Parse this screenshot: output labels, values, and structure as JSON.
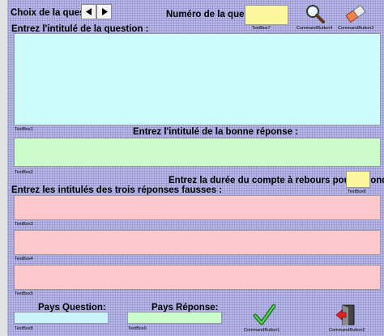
{
  "header": {
    "choix_label": "Choix de la question",
    "numero_label": "Numéro de la question :",
    "textbox7": "TextBox7",
    "cmd4": "CommandButton4",
    "cmd3": "CommandButton3"
  },
  "question": {
    "label": "Entrez l'intitulé de la question :",
    "box_caption": "TextBox1"
  },
  "bonne": {
    "label": "Entrez l'intitulé de la bonne réponse :",
    "box_caption": "TextBox2"
  },
  "duree": {
    "label": "Entrez la durée du compte à rebours pour répondre :",
    "box_caption": "TextBox6"
  },
  "fausses": {
    "label": "Entrez les intitulés des trois réponses fausses :",
    "captions": [
      "TextBox3",
      "TextBox4",
      "TextBox5"
    ]
  },
  "footer": {
    "pays_question": "Pays Question:",
    "pays_reponse": "Pays Réponse:",
    "textbox8": "TextBox8",
    "textbox9": "TextBox9",
    "cmd1": "CommandButton1",
    "cmd2": "CommandButton2"
  },
  "icons": {
    "prev": "arrow-left-icon",
    "next": "arrow-right-icon",
    "search": "magnifier-icon",
    "eraser": "eraser-icon",
    "validate": "checkmark-icon",
    "exit": "exit-door-icon"
  }
}
